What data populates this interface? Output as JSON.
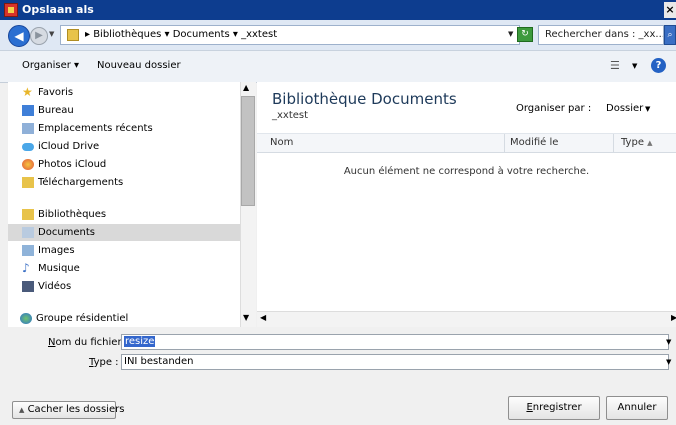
{
  "window": {
    "title": "Opslaan als",
    "close_label": "×"
  },
  "address": {
    "path": "▸ Bibliothèques ▾ Documents ▾ _xxtest",
    "search_placeholder": "Rechercher dans : _xx..."
  },
  "toolbar": {
    "organize_label": "Organiser ▾",
    "new_folder_label": "Nouveau dossier"
  },
  "nav": {
    "favorites": "Favoris",
    "items": [
      {
        "label": "Bureau"
      },
      {
        "label": "Emplacements récents"
      },
      {
        "label": "iCloud Drive"
      },
      {
        "label": "Photos iCloud"
      },
      {
        "label": "Téléchargements"
      }
    ],
    "libraries": "Bibliothèques",
    "lib_items": [
      {
        "label": "Documents"
      },
      {
        "label": "Images"
      },
      {
        "label": "Musique"
      },
      {
        "label": "Vidéos"
      }
    ],
    "homegroup": "Groupe résidentiel"
  },
  "content": {
    "title": "Bibliothèque Documents",
    "subtitle": "_xxtest",
    "arrange_label": "Organiser par :",
    "arrange_value": "Dossier",
    "columns": [
      "Nom",
      "Modifié le",
      "Type"
    ],
    "empty_message": "Aucun élément ne correspond à votre recherche."
  },
  "form": {
    "filename_label_u": "N",
    "filename_label_rest": "om du fichier :",
    "filename_value": "resize",
    "type_label_u": "T",
    "type_label_rest": "ype :",
    "type_value": "INI bestanden"
  },
  "buttons": {
    "hide_folders": "Cacher les dossiers",
    "save_u": "E",
    "save_rest": "nregistrer",
    "cancel": "Annuler"
  }
}
